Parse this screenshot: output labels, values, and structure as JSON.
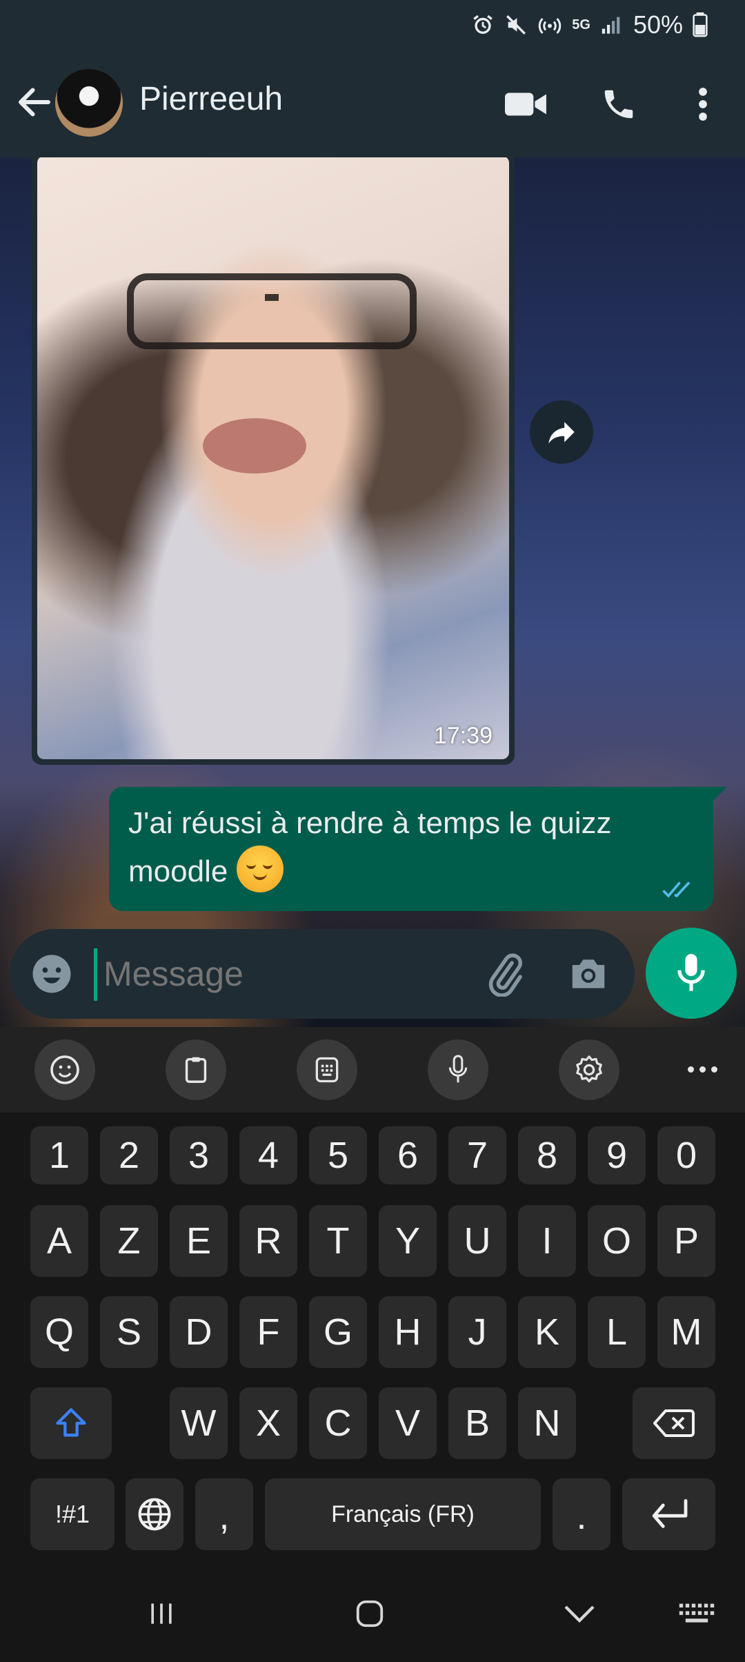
{
  "status_bar": {
    "battery": "50%",
    "network": "5G"
  },
  "header": {
    "contact_name": "Pierreeuh"
  },
  "messages": {
    "photo_time": "17:39",
    "outgoing_text": "J'ai réussi à rendre à temps le quizz moodle",
    "outgoing_status": "read"
  },
  "composer": {
    "placeholder": "Message"
  },
  "keyboard": {
    "number_row": [
      "1",
      "2",
      "3",
      "4",
      "5",
      "6",
      "7",
      "8",
      "9",
      "0"
    ],
    "row1": [
      "A",
      "Z",
      "E",
      "R",
      "T",
      "Y",
      "U",
      "I",
      "O",
      "P"
    ],
    "row2": [
      "Q",
      "S",
      "D",
      "F",
      "G",
      "H",
      "J",
      "K",
      "L",
      "M"
    ],
    "row3": [
      "W",
      "X",
      "C",
      "V",
      "B",
      "N"
    ],
    "symbols_key": "!#1",
    "comma_key": ",",
    "space_label": "Français (FR)",
    "period_key": "."
  },
  "colors": {
    "accent": "#00a884",
    "bubble_out": "#005c4b",
    "header_bg": "#1f2c34",
    "read_ticks": "#53bdeb",
    "shift_blue": "#3b82f6"
  }
}
